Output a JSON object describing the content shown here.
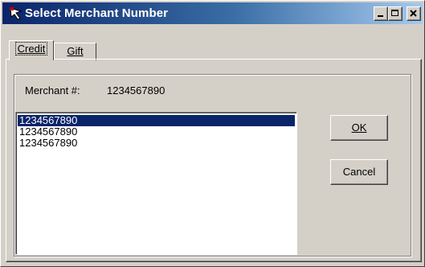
{
  "window": {
    "title": "Select Merchant Number"
  },
  "tabs": [
    {
      "label": "Credit",
      "selected": true
    },
    {
      "label": "Gift",
      "selected": false
    }
  ],
  "merchant": {
    "label": "Merchant #:",
    "value": "1234567890"
  },
  "list": {
    "items": [
      "1234567890",
      "1234567890",
      "1234567890"
    ],
    "selected_index": 0
  },
  "buttons": {
    "ok": "OK",
    "cancel": "Cancel"
  },
  "colors": {
    "title_start": "#0a246a",
    "title_end": "#a6caf0",
    "selection": "#0a246a",
    "face": "#d4d0c8"
  }
}
